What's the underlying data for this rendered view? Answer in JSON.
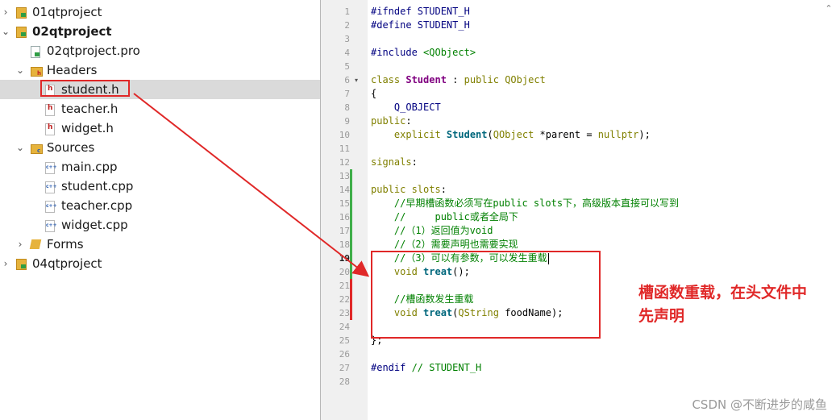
{
  "tree": {
    "items": [
      {
        "label": "01qtproject",
        "icon": "project-icon",
        "arrow": "›",
        "level": 0,
        "bold": false
      },
      {
        "label": "02qtproject",
        "icon": "project-icon",
        "arrow": "⌄",
        "level": 0,
        "bold": true
      },
      {
        "label": "02qtproject.pro",
        "icon": "pro-file-icon",
        "arrow": "",
        "level": 1,
        "bold": false
      },
      {
        "label": "Headers",
        "icon": "headers-folder-icon",
        "arrow": "⌄",
        "level": 1,
        "bold": false
      },
      {
        "label": "student.h",
        "icon": "header-file-icon",
        "arrow": "",
        "level": 2,
        "bold": false,
        "selected": true
      },
      {
        "label": "teacher.h",
        "icon": "header-file-icon",
        "arrow": "",
        "level": 2,
        "bold": false
      },
      {
        "label": "widget.h",
        "icon": "header-file-icon",
        "arrow": "",
        "level": 2,
        "bold": false
      },
      {
        "label": "Sources",
        "icon": "sources-folder-icon",
        "arrow": "⌄",
        "level": 1,
        "bold": false
      },
      {
        "label": "main.cpp",
        "icon": "cpp-file-icon",
        "arrow": "",
        "level": 2,
        "bold": false
      },
      {
        "label": "student.cpp",
        "icon": "cpp-file-icon",
        "arrow": "",
        "level": 2,
        "bold": false
      },
      {
        "label": "teacher.cpp",
        "icon": "cpp-file-icon",
        "arrow": "",
        "level": 2,
        "bold": false
      },
      {
        "label": "widget.cpp",
        "icon": "cpp-file-icon",
        "arrow": "",
        "level": 2,
        "bold": false
      },
      {
        "label": "Forms",
        "icon": "forms-folder-icon",
        "arrow": "›",
        "level": 1,
        "bold": false
      },
      {
        "label": "04qtproject",
        "icon": "project-icon",
        "arrow": "›",
        "level": 0,
        "bold": false
      }
    ]
  },
  "editor": {
    "current_line": 19,
    "lines": [
      {
        "n": "1",
        "tokens": [
          {
            "t": "#ifndef STUDENT_H",
            "c": "pre"
          }
        ]
      },
      {
        "n": "2",
        "tokens": [
          {
            "t": "#define STUDENT_H",
            "c": "pre"
          }
        ]
      },
      {
        "n": "3",
        "tokens": []
      },
      {
        "n": "4",
        "tokens": [
          {
            "t": "#include ",
            "c": "pre"
          },
          {
            "t": "<QObject>",
            "c": "inc"
          }
        ]
      },
      {
        "n": "5",
        "tokens": []
      },
      {
        "n": "6",
        "tokens": [
          {
            "t": "class ",
            "c": "kw"
          },
          {
            "t": "Student",
            "c": "cls"
          },
          {
            "t": " : ",
            "c": "plain"
          },
          {
            "t": "public ",
            "c": "kw"
          },
          {
            "t": "QObject",
            "c": "cls2"
          }
        ]
      },
      {
        "n": "7",
        "tokens": [
          {
            "t": "{",
            "c": "plain"
          }
        ]
      },
      {
        "n": "8",
        "tokens": [
          {
            "t": "    Q_OBJECT",
            "c": "mac"
          }
        ]
      },
      {
        "n": "9",
        "tokens": [
          {
            "t": "public",
            "c": "kw"
          },
          {
            "t": ":",
            "c": "plain"
          }
        ]
      },
      {
        "n": "10",
        "tokens": [
          {
            "t": "    explicit ",
            "c": "kw"
          },
          {
            "t": "Student",
            "c": "fn"
          },
          {
            "t": "(",
            "c": "plain"
          },
          {
            "t": "QObject",
            "c": "cls2"
          },
          {
            "t": " *parent = ",
            "c": "plain"
          },
          {
            "t": "nullptr",
            "c": "kw"
          },
          {
            "t": ");",
            "c": "plain"
          }
        ]
      },
      {
        "n": "11",
        "tokens": []
      },
      {
        "n": "12",
        "tokens": [
          {
            "t": "signals",
            "c": "kw"
          },
          {
            "t": ":",
            "c": "plain"
          }
        ]
      },
      {
        "n": "13",
        "tokens": []
      },
      {
        "n": "14",
        "tokens": [
          {
            "t": "public ",
            "c": "kw"
          },
          {
            "t": "slots",
            "c": "kw"
          },
          {
            "t": ":",
            "c": "plain"
          }
        ]
      },
      {
        "n": "15",
        "tokens": [
          {
            "t": "    //早期槽函数必须写在public slots下，高级版本直接可以写到",
            "c": "com"
          }
        ]
      },
      {
        "n": "16",
        "tokens": [
          {
            "t": "    //     public或者全局下",
            "c": "com"
          }
        ]
      },
      {
        "n": "17",
        "tokens": [
          {
            "t": "    //（1）返回值为void",
            "c": "com"
          }
        ]
      },
      {
        "n": "18",
        "tokens": [
          {
            "t": "    //（2）需要声明也需要实现",
            "c": "com"
          }
        ]
      },
      {
        "n": "19",
        "tokens": [
          {
            "t": "    //（3）可以有参数，可以发生重载",
            "c": "com"
          }
        ]
      },
      {
        "n": "20",
        "tokens": [
          {
            "t": "    void ",
            "c": "kw"
          },
          {
            "t": "treat",
            "c": "fn"
          },
          {
            "t": "();",
            "c": "plain"
          }
        ]
      },
      {
        "n": "21",
        "tokens": []
      },
      {
        "n": "22",
        "tokens": [
          {
            "t": "    //槽函数发生重载",
            "c": "com"
          }
        ]
      },
      {
        "n": "23",
        "tokens": [
          {
            "t": "    void ",
            "c": "kw"
          },
          {
            "t": "treat",
            "c": "fn"
          },
          {
            "t": "(",
            "c": "plain"
          },
          {
            "t": "QString",
            "c": "cls2"
          },
          {
            "t": " foodName);",
            "c": "plain"
          }
        ]
      },
      {
        "n": "24",
        "tokens": []
      },
      {
        "n": "25",
        "tokens": [
          {
            "t": "};",
            "c": "plain"
          }
        ]
      },
      {
        "n": "26",
        "tokens": []
      },
      {
        "n": "27",
        "tokens": [
          {
            "t": "#endif ",
            "c": "pre"
          },
          {
            "t": "// STUDENT_H",
            "c": "com"
          }
        ]
      },
      {
        "n": "28",
        "tokens": []
      }
    ]
  },
  "annotation": {
    "line1": "槽函数重载，在头文件中",
    "line2": "先声明"
  },
  "watermark": "CSDN @不断进步的咸鱼",
  "colors": {
    "highlight": "#e02828",
    "change_green": "#3fae49",
    "change_red": "#e02828"
  }
}
